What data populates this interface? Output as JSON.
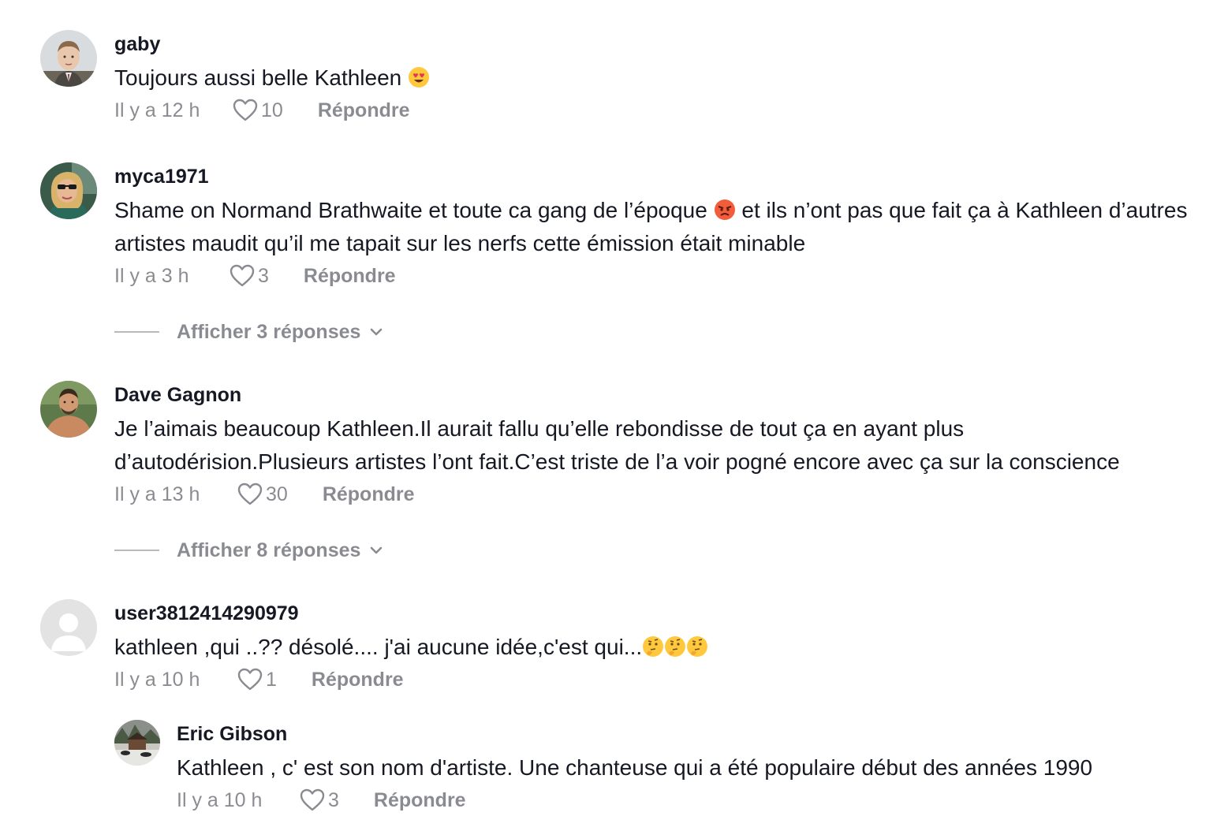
{
  "comments": [
    {
      "username": "gaby",
      "text": "Toujours aussi belle Kathleen",
      "emoji": "heart-eyes",
      "time": "Il y a 12 h",
      "likes": "10",
      "reply_label": "Répondre"
    },
    {
      "username": "myca1971",
      "text_part1": "Shame on Normand Brathwaite et toute ca gang de l’époque",
      "emoji": "angry-face",
      "text_part2": "et ils n’ont pas que fait ça à Kathleen d’autres artistes maudit qu’il me tapait sur les nerfs cette émission était minable",
      "time": "Il y a 3 h",
      "likes": "3",
      "reply_label": "Répondre",
      "view_replies": "Afficher 3 réponses"
    },
    {
      "username": "Dave Gagnon",
      "text": "Je l’aimais beaucoup Kathleen.Il aurait fallu qu’elle rebondisse de tout ça en ayant plus d’autodérision.Plusieurs artistes l’ont fait.C’est triste de l’a voir pogné encore avec ça sur la conscience",
      "time": "Il y a 13 h",
      "likes": "30",
      "reply_label": "Répondre",
      "view_replies": "Afficher 8 réponses"
    },
    {
      "username": "user3812414290979",
      "text": "kathleen ,qui ..?? désolé.... j'ai aucune idée,c'est qui...",
      "emoji": "thinking-face",
      "time": "Il y a 10 h",
      "likes": "1",
      "reply_label": "Répondre"
    },
    {
      "username": "Eric Gibson",
      "text": "Kathleen , c' est son nom d'artiste. Une chanteuse qui a été populaire début des années 1990",
      "time": "Il y a 10 h",
      "likes": "3",
      "reply_label": "Répondre"
    }
  ],
  "colors": {
    "text": "#161823",
    "muted": "rgba(22,24,35,0.5)",
    "emoji_yellow": "#FFC83D",
    "emoji_angry": "#F25C3A"
  }
}
